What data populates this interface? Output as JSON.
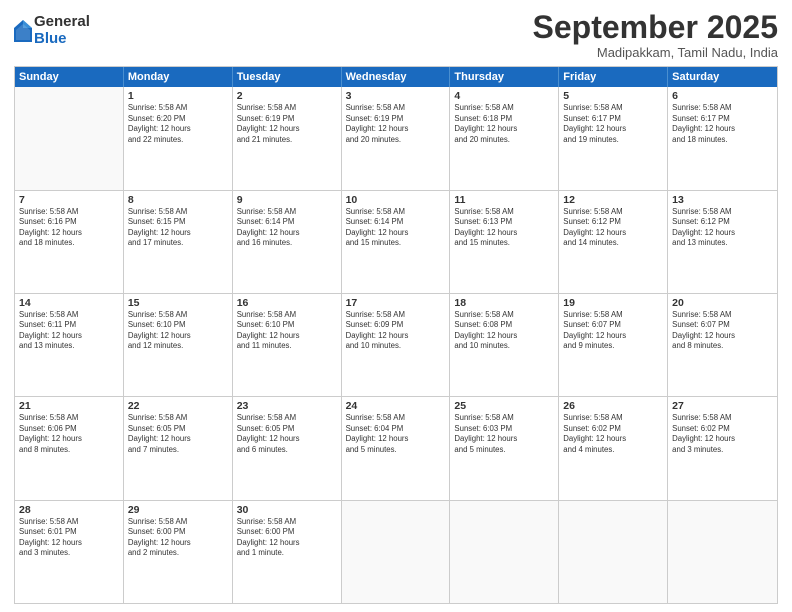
{
  "logo": {
    "general": "General",
    "blue": "Blue"
  },
  "title": "September 2025",
  "location": "Madipakkam, Tamil Nadu, India",
  "header_days": [
    "Sunday",
    "Monday",
    "Tuesday",
    "Wednesday",
    "Thursday",
    "Friday",
    "Saturday"
  ],
  "rows": [
    [
      {
        "day": "",
        "info": ""
      },
      {
        "day": "1",
        "info": "Sunrise: 5:58 AM\nSunset: 6:20 PM\nDaylight: 12 hours\nand 22 minutes."
      },
      {
        "day": "2",
        "info": "Sunrise: 5:58 AM\nSunset: 6:19 PM\nDaylight: 12 hours\nand 21 minutes."
      },
      {
        "day": "3",
        "info": "Sunrise: 5:58 AM\nSunset: 6:19 PM\nDaylight: 12 hours\nand 20 minutes."
      },
      {
        "day": "4",
        "info": "Sunrise: 5:58 AM\nSunset: 6:18 PM\nDaylight: 12 hours\nand 20 minutes."
      },
      {
        "day": "5",
        "info": "Sunrise: 5:58 AM\nSunset: 6:17 PM\nDaylight: 12 hours\nand 19 minutes."
      },
      {
        "day": "6",
        "info": "Sunrise: 5:58 AM\nSunset: 6:17 PM\nDaylight: 12 hours\nand 18 minutes."
      }
    ],
    [
      {
        "day": "7",
        "info": "Sunrise: 5:58 AM\nSunset: 6:16 PM\nDaylight: 12 hours\nand 18 minutes."
      },
      {
        "day": "8",
        "info": "Sunrise: 5:58 AM\nSunset: 6:15 PM\nDaylight: 12 hours\nand 17 minutes."
      },
      {
        "day": "9",
        "info": "Sunrise: 5:58 AM\nSunset: 6:14 PM\nDaylight: 12 hours\nand 16 minutes."
      },
      {
        "day": "10",
        "info": "Sunrise: 5:58 AM\nSunset: 6:14 PM\nDaylight: 12 hours\nand 15 minutes."
      },
      {
        "day": "11",
        "info": "Sunrise: 5:58 AM\nSunset: 6:13 PM\nDaylight: 12 hours\nand 15 minutes."
      },
      {
        "day": "12",
        "info": "Sunrise: 5:58 AM\nSunset: 6:12 PM\nDaylight: 12 hours\nand 14 minutes."
      },
      {
        "day": "13",
        "info": "Sunrise: 5:58 AM\nSunset: 6:12 PM\nDaylight: 12 hours\nand 13 minutes."
      }
    ],
    [
      {
        "day": "14",
        "info": "Sunrise: 5:58 AM\nSunset: 6:11 PM\nDaylight: 12 hours\nand 13 minutes."
      },
      {
        "day": "15",
        "info": "Sunrise: 5:58 AM\nSunset: 6:10 PM\nDaylight: 12 hours\nand 12 minutes."
      },
      {
        "day": "16",
        "info": "Sunrise: 5:58 AM\nSunset: 6:10 PM\nDaylight: 12 hours\nand 11 minutes."
      },
      {
        "day": "17",
        "info": "Sunrise: 5:58 AM\nSunset: 6:09 PM\nDaylight: 12 hours\nand 10 minutes."
      },
      {
        "day": "18",
        "info": "Sunrise: 5:58 AM\nSunset: 6:08 PM\nDaylight: 12 hours\nand 10 minutes."
      },
      {
        "day": "19",
        "info": "Sunrise: 5:58 AM\nSunset: 6:07 PM\nDaylight: 12 hours\nand 9 minutes."
      },
      {
        "day": "20",
        "info": "Sunrise: 5:58 AM\nSunset: 6:07 PM\nDaylight: 12 hours\nand 8 minutes."
      }
    ],
    [
      {
        "day": "21",
        "info": "Sunrise: 5:58 AM\nSunset: 6:06 PM\nDaylight: 12 hours\nand 8 minutes."
      },
      {
        "day": "22",
        "info": "Sunrise: 5:58 AM\nSunset: 6:05 PM\nDaylight: 12 hours\nand 7 minutes."
      },
      {
        "day": "23",
        "info": "Sunrise: 5:58 AM\nSunset: 6:05 PM\nDaylight: 12 hours\nand 6 minutes."
      },
      {
        "day": "24",
        "info": "Sunrise: 5:58 AM\nSunset: 6:04 PM\nDaylight: 12 hours\nand 5 minutes."
      },
      {
        "day": "25",
        "info": "Sunrise: 5:58 AM\nSunset: 6:03 PM\nDaylight: 12 hours\nand 5 minutes."
      },
      {
        "day": "26",
        "info": "Sunrise: 5:58 AM\nSunset: 6:02 PM\nDaylight: 12 hours\nand 4 minutes."
      },
      {
        "day": "27",
        "info": "Sunrise: 5:58 AM\nSunset: 6:02 PM\nDaylight: 12 hours\nand 3 minutes."
      }
    ],
    [
      {
        "day": "28",
        "info": "Sunrise: 5:58 AM\nSunset: 6:01 PM\nDaylight: 12 hours\nand 3 minutes."
      },
      {
        "day": "29",
        "info": "Sunrise: 5:58 AM\nSunset: 6:00 PM\nDaylight: 12 hours\nand 2 minutes."
      },
      {
        "day": "30",
        "info": "Sunrise: 5:58 AM\nSunset: 6:00 PM\nDaylight: 12 hours\nand 1 minute."
      },
      {
        "day": "",
        "info": ""
      },
      {
        "day": "",
        "info": ""
      },
      {
        "day": "",
        "info": ""
      },
      {
        "day": "",
        "info": ""
      }
    ]
  ]
}
